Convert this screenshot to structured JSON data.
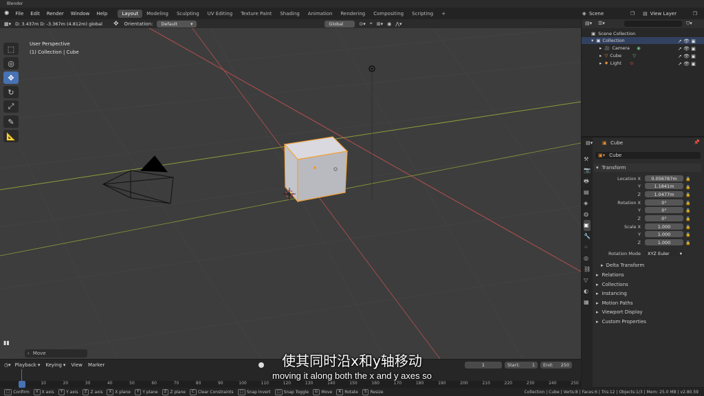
{
  "window": {
    "title": "Blender"
  },
  "menus": [
    "File",
    "Edit",
    "Render",
    "Window",
    "Help"
  ],
  "workspaces": [
    "Layout",
    "Modeling",
    "Sculpting",
    "UV Editing",
    "Texture Paint",
    "Shading",
    "Animation",
    "Rendering",
    "Compositing",
    "Scripting"
  ],
  "add_tab": "+",
  "scene": {
    "label": "Scene",
    "view_layer": "View Layer"
  },
  "header": {
    "readout": "D: 3.437m  D: -3.367m (4.812m) global",
    "orientation_label": "Orientation:",
    "orientation_value": "Default",
    "transform_orientation": "Global"
  },
  "viewport": {
    "perspective": "User Perspective",
    "collection": "(1) Collection | Cube",
    "operator_panel": "Move"
  },
  "outliner": {
    "search_placeholder": "",
    "root": "Scene Collection",
    "collection": "Collection",
    "items": [
      "Camera",
      "Cube",
      "Light"
    ]
  },
  "properties": {
    "object_name": "Cube",
    "data_name": "Cube",
    "transform_label": "Transform",
    "location_label": "Location X",
    "rotation_label": "Rotation X",
    "scale_label": "Scale X",
    "axis_y": "Y",
    "axis_z": "Z",
    "location": [
      "0.056787m",
      "1.1841m",
      "1.0477m"
    ],
    "rotation": [
      "0°",
      "0°",
      "0°"
    ],
    "scale": [
      "1.000",
      "1.000",
      "1.000"
    ],
    "rotation_mode_label": "Rotation Mode",
    "rotation_mode": "XYZ Euler",
    "delta_transform": "Delta Transform",
    "panels": [
      "Relations",
      "Collections",
      "Instancing",
      "Motion Paths",
      "Viewport Display",
      "Custom Properties"
    ]
  },
  "timeline": {
    "menus": [
      "Playback",
      "Keying",
      "View",
      "Marker"
    ],
    "current_frame": "1",
    "start_label": "Start:",
    "start": "1",
    "end_label": "End:",
    "end": "250",
    "ticks": [
      "1",
      "10",
      "20",
      "30",
      "40",
      "50",
      "60",
      "70",
      "80",
      "90",
      "100",
      "110",
      "120",
      "130",
      "140",
      "150",
      "160",
      "170",
      "180",
      "190",
      "200",
      "210",
      "220",
      "230",
      "240",
      "250"
    ]
  },
  "subtitle": {
    "zh": "使其同时沿x和y轴移动",
    "en": "moving it along both the x and y axes so"
  },
  "status": {
    "items": [
      {
        "key": "",
        "label": "Confirm"
      },
      {
        "key": "X",
        "label": "X axis"
      },
      {
        "key": "Y",
        "label": "Y axis"
      },
      {
        "key": "Z",
        "label": "Z axis"
      },
      {
        "key": "X",
        "label": "X plane"
      },
      {
        "key": "Y",
        "label": "Y plane"
      },
      {
        "key": "Z",
        "label": "Z plane"
      },
      {
        "key": "C",
        "label": "Clear Constraints"
      },
      {
        "key": "",
        "label": "Snap Invert"
      },
      {
        "key": "",
        "label": "Snap Toggle"
      },
      {
        "key": "G",
        "label": "Move"
      },
      {
        "key": "R",
        "label": "Rotate"
      },
      {
        "key": "S",
        "label": "Resize"
      }
    ],
    "stats": "Collection | Cube | Verts:8 | Faces:6 | Tris:12 | Objects:1/3 | Mem: 25.0 MB | v2.80.59"
  },
  "colors": {
    "accent": "#4772b3",
    "x_axis": "#c75a5a",
    "y_axis": "#9aab3c",
    "selection": "#ffa53a"
  }
}
